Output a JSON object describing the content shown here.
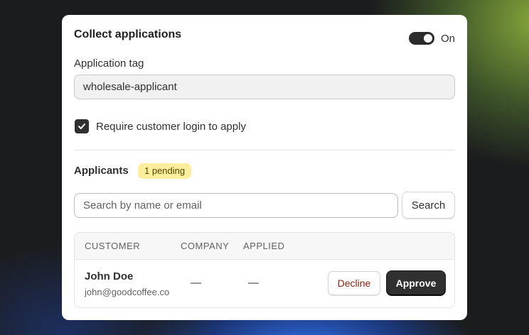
{
  "section": {
    "title": "Collect applications",
    "toggle": {
      "state": true,
      "label": "On"
    }
  },
  "application_tag": {
    "label": "Application tag",
    "value": "wholesale-applicant"
  },
  "login_requirement": {
    "checked": true,
    "label": "Require customer login to apply"
  },
  "applicants": {
    "title": "Applicants",
    "badge": "1 pending",
    "search": {
      "placeholder": "Search by name or email",
      "value": "",
      "button_label": "Search"
    },
    "table": {
      "columns": [
        "CUSTOMER",
        "COMPANY",
        "APPLIED"
      ],
      "rows": [
        {
          "name": "John Doe",
          "email": "john@goodcoffee.co",
          "company": "—",
          "applied": "—",
          "decline_label": "Decline",
          "approve_label": "Approve"
        }
      ]
    }
  }
}
